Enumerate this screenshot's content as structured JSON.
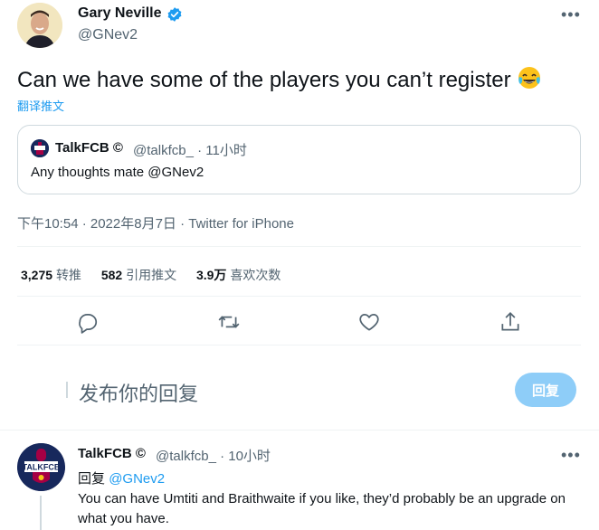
{
  "author": {
    "name": "Gary Neville",
    "handle": "@GNev2"
  },
  "tweet": {
    "text": "Can we have some of the players you can’t register",
    "emoji": "face-with-tears-of-joy",
    "translate_label": "翻译推文"
  },
  "quote": {
    "name": "TalkFCB",
    "badge": "©",
    "meta": "@talkfcb_ · 11小时",
    "text": "Any thoughts mate @GNev2"
  },
  "timestamp": "下午10:54 · 2022年8月7日 · Twitter for iPhone",
  "stats": {
    "retweets_count": "3,275",
    "retweets_label": "转推",
    "quotes_count": "582",
    "quotes_label": "引用推文",
    "likes_count": "3.9万",
    "likes_label": "喜欢次数"
  },
  "compose": {
    "placeholder": "发布你的回复",
    "button_label": "回复"
  },
  "reply": {
    "name": "TalkFCB",
    "badge": "©",
    "meta": "@talkfcb_ · 10小时",
    "replying_prefix": "回复",
    "replying_to": "@GNev2",
    "text": "You can have Umtiti and Braithwaite if you like, they’d probably be an upgrade on what you have."
  },
  "colors": {
    "accent": "#1d9bf0",
    "muted": "#536471",
    "reply_button": "#8ecdf8"
  }
}
